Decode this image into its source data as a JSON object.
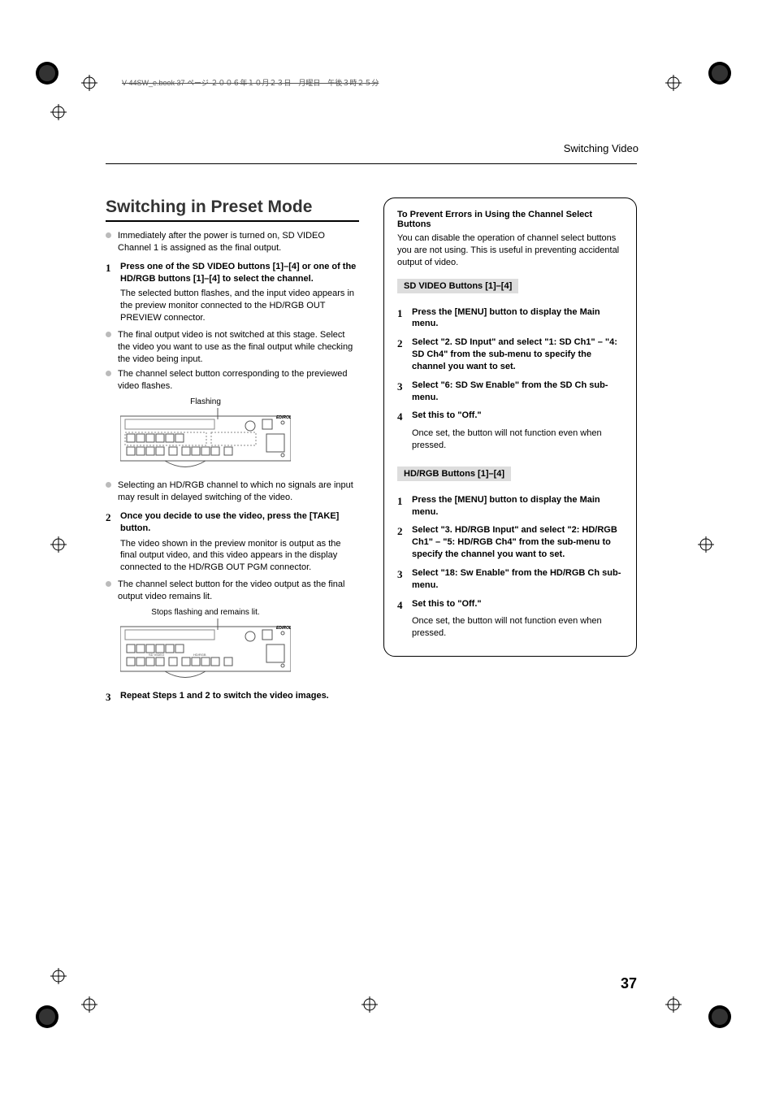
{
  "header": {
    "filename": "V-44SW_e.book  37 ページ  ２００６年１０月２３日　月曜日　午後３時２５分"
  },
  "chapter": "Switching Video",
  "left": {
    "section_title": "Switching in Preset Mode",
    "intro_bullet": "Immediately after the power is turned on, SD VIDEO Channel 1 is assigned as the final output.",
    "step1_bold": "Press one of the SD VIDEO buttons [1]–[4] or one of the HD/RGB buttons [1]–[4] to select the channel.",
    "step1_body": "The selected button flashes, and the input video appears in the preview monitor connected to the HD/RGB OUT PREVIEW connector.",
    "step1_b1": "The final output video is not switched at this stage. Select the video you want to use as the final output while checking the video being input.",
    "step1_b2": "The channel select button corresponding to the previewed video flashes.",
    "fig1_caption": "Flashing",
    "step1_b3": "Selecting an HD/RGB channel to which no signals are input may result in delayed switching of the video.",
    "step2_bold": "Once you decide to use the video, press the [TAKE] button.",
    "step2_body": "The video shown in the preview monitor is output as the final output video, and this video appears in the display connected to the HD/RGB OUT PGM connector.",
    "step2_b1": "The channel select button for the video output as the final output video remains lit.",
    "fig2_caption": "Stops flashing and remains lit.",
    "step3_bold": "Repeat Steps 1 and 2 to switch the video images."
  },
  "right": {
    "box_title": "To Prevent Errors in Using the Channel Select Buttons",
    "box_intro": "You can disable the operation of channel select buttons you are not using. This is useful in preventing accidental output of video.",
    "sd_head": "SD VIDEO Buttons [1]–[4]",
    "sd1": "Press the [MENU] button to display the Main menu.",
    "sd2": "Select \"2. SD Input\" and select \"1: SD Ch1\" – \"4: SD Ch4\" from the sub-menu to specify the channel you want to set.",
    "sd3": "Select \"6: SD Sw Enable\" from the SD Ch sub-menu.",
    "sd4": "Set this to \"Off.\"",
    "sd4_body": "Once set, the button will not function even when pressed.",
    "hd_head": "HD/RGB Buttons [1]–[4]",
    "hd1": "Press the [MENU] button to display the Main menu.",
    "hd2": "Select \"3. HD/RGB Input\" and select \"2: HD/RGB Ch1\" – \"5: HD/RGB Ch4\" from the sub-menu to specify the channel you want to set.",
    "hd3": "Select \"18: Sw Enable\" from the HD/RGB Ch sub-menu.",
    "hd4": "Set this to \"Off.\"",
    "hd4_body": "Once set, the button will not function even when pressed."
  },
  "page_number": "37"
}
